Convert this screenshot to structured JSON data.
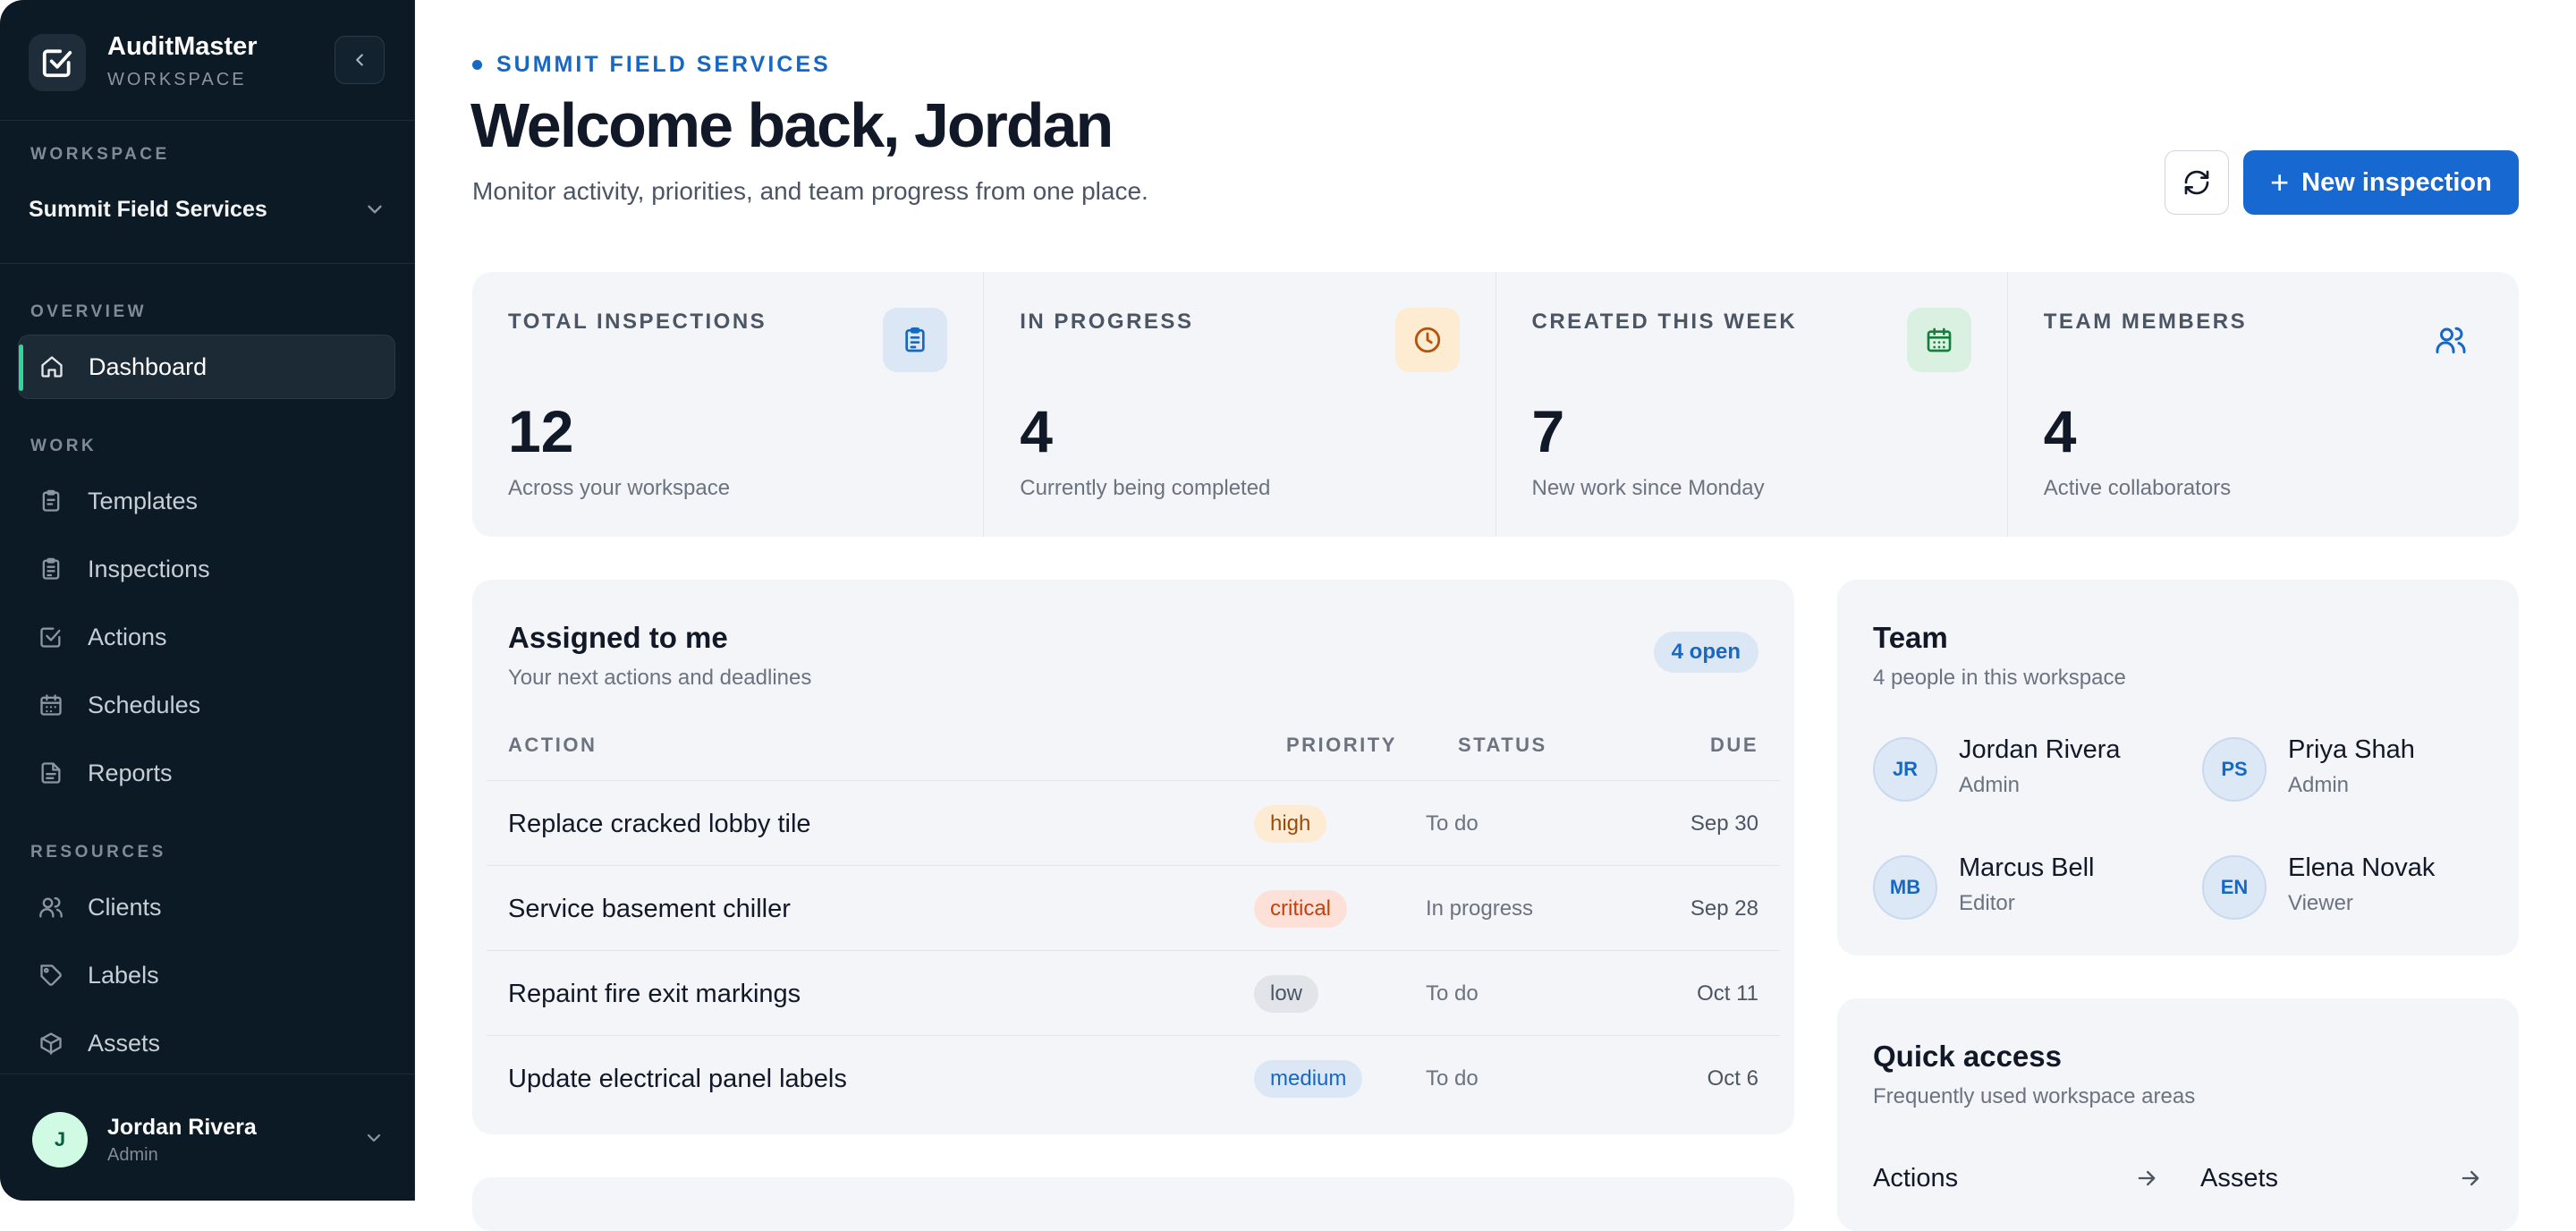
{
  "app": {
    "name": "AuditMaster",
    "subtitle": "WORKSPACE"
  },
  "sidebar": {
    "workspace_label": "WORKSPACE",
    "workspace_name": "Summit Field Services",
    "sections": {
      "overview": "OVERVIEW",
      "work": "WORK",
      "resources": "RESOURCES"
    },
    "items": [
      {
        "label": "Dashboard",
        "icon": "home-icon",
        "active": true
      },
      {
        "label": "Templates",
        "icon": "clipboard-icon"
      },
      {
        "label": "Inspections",
        "icon": "clipboard-list-icon"
      },
      {
        "label": "Actions",
        "icon": "check-square-icon"
      },
      {
        "label": "Schedules",
        "icon": "calendar-icon"
      },
      {
        "label": "Reports",
        "icon": "file-text-icon"
      },
      {
        "label": "Clients",
        "icon": "users-icon"
      },
      {
        "label": "Labels",
        "icon": "tag-icon"
      },
      {
        "label": "Assets",
        "icon": "box-icon"
      }
    ],
    "user": {
      "initial": "J",
      "name": "Jordan Rivera",
      "role": "Admin"
    }
  },
  "header": {
    "eyebrow": "SUMMIT FIELD SERVICES",
    "title": "Welcome back, Jordan",
    "subtitle": "Monitor activity, priorities, and team progress from one place.",
    "new_button": "New inspection",
    "new_button_icon": "+"
  },
  "stats": [
    {
      "label": "TOTAL INSPECTIONS",
      "value": "12",
      "note": "Across your workspace",
      "icon": "clipboard-icon",
      "color": "#1768c4"
    },
    {
      "label": "IN PROGRESS",
      "value": "4",
      "note": "Currently being completed",
      "icon": "clock-icon",
      "color": "#b45309"
    },
    {
      "label": "CREATED THIS WEEK",
      "value": "7",
      "note": "New work since Monday",
      "icon": "calendar-icon",
      "color": "#15803d"
    },
    {
      "label": "TEAM MEMBERS",
      "value": "4",
      "note": "Active collaborators",
      "icon": "users-icon",
      "color": "#1768c4"
    }
  ],
  "assigned": {
    "title": "Assigned to me",
    "subtitle": "Your next actions and deadlines",
    "badge": "4 open",
    "columns": {
      "action": "ACTION",
      "priority": "PRIORITY",
      "status": "STATUS",
      "due": "DUE"
    },
    "rows": [
      {
        "action": "Replace cracked lobby tile",
        "priority": "high",
        "status": "To do",
        "due": "Sep 30"
      },
      {
        "action": "Service basement chiller",
        "priority": "critical",
        "status": "In progress",
        "due": "Sep 28"
      },
      {
        "action": "Repaint fire exit markings",
        "priority": "low",
        "status": "To do",
        "due": "Oct 11"
      },
      {
        "action": "Update electrical panel labels",
        "priority": "medium",
        "status": "To do",
        "due": "Oct 6"
      }
    ]
  },
  "team": {
    "title": "Team",
    "subtitle": "4 people in this workspace",
    "members": [
      {
        "initials": "JR",
        "name": "Jordan Rivera",
        "role": "Admin"
      },
      {
        "initials": "PS",
        "name": "Priya Shah",
        "role": "Admin"
      },
      {
        "initials": "MB",
        "name": "Marcus Bell",
        "role": "Editor"
      },
      {
        "initials": "EN",
        "name": "Elena Novak",
        "role": "Viewer"
      }
    ]
  },
  "quick_access": {
    "title": "Quick access",
    "subtitle": "Frequently used workspace areas",
    "items": [
      {
        "label": "Actions"
      },
      {
        "label": "Assets"
      }
    ]
  }
}
